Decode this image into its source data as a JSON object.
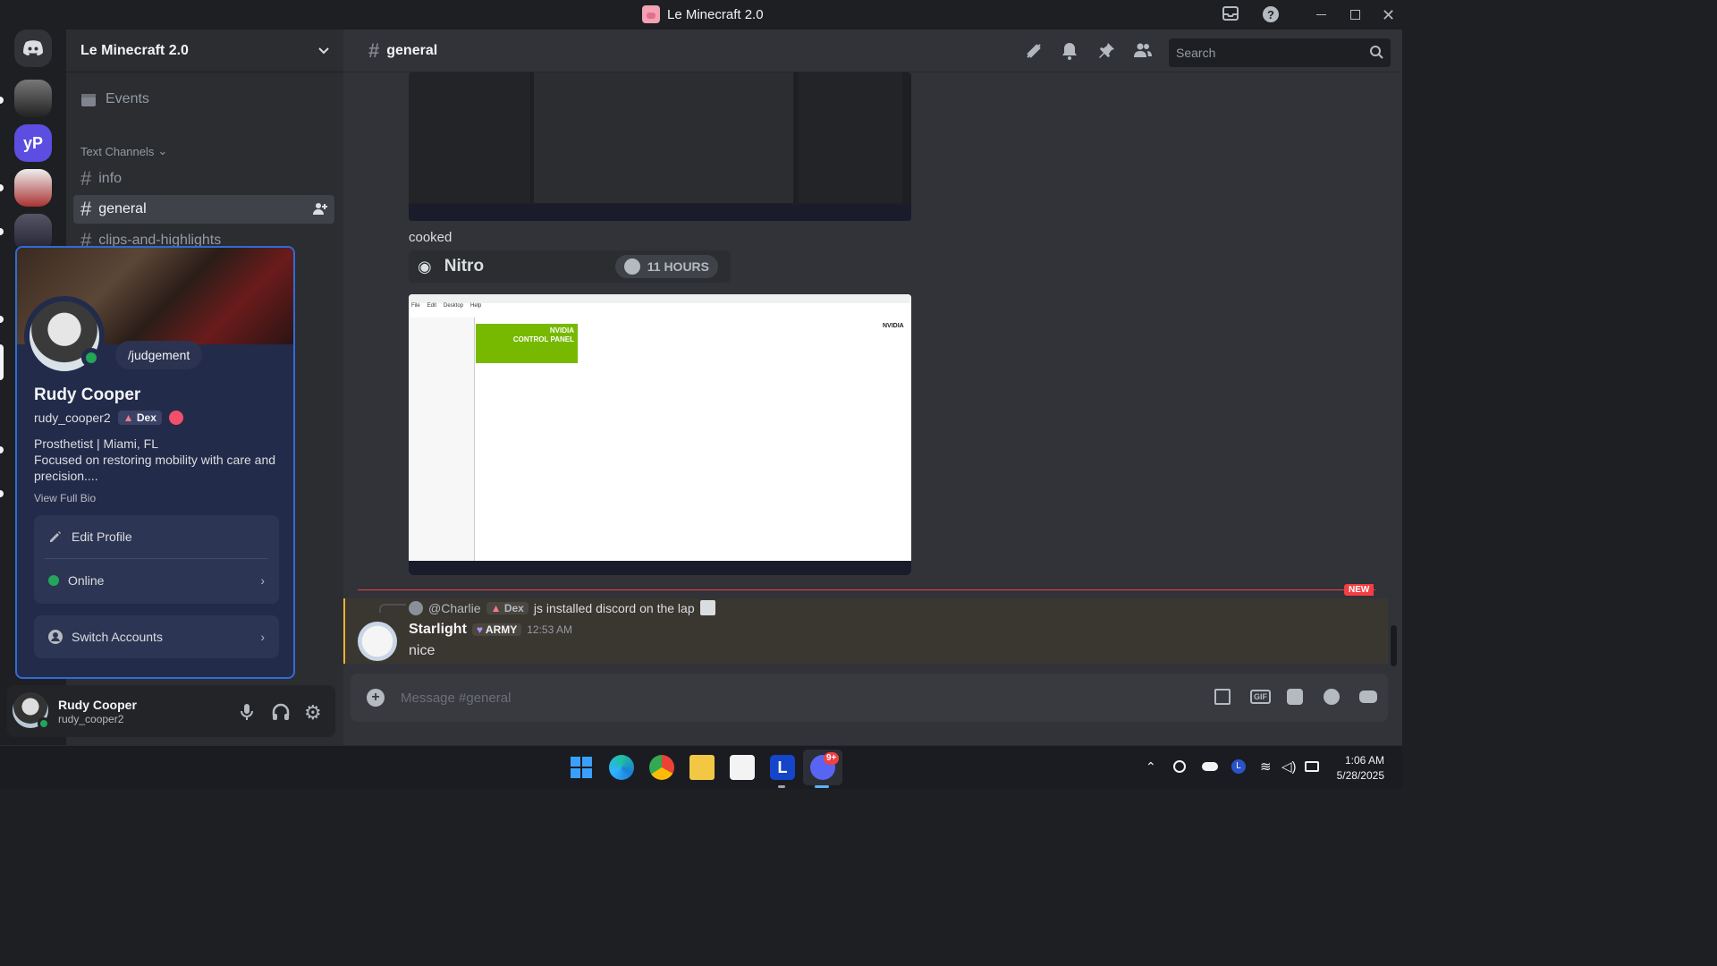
{
  "window": {
    "title": "Le Minecraft 2.0"
  },
  "server": {
    "name": "Le Minecraft 2.0",
    "events_label": "Events",
    "category": "Text Channels"
  },
  "channels": [
    {
      "name": "info"
    },
    {
      "name": "general"
    },
    {
      "name": "clips-and-highlights"
    }
  ],
  "header": {
    "channel": "general",
    "search_placeholder": "Search"
  },
  "profile": {
    "status_text": "/judgement",
    "display_name": "Rudy Cooper",
    "username": "rudy_cooper2",
    "tag": "Dex",
    "bio_line1": "Prosthetist | Miami, FL",
    "bio_line2": "Focused on restoring mobility with care and precision....",
    "view_bio": "View Full Bio",
    "edit_profile": "Edit Profile",
    "online": "Online",
    "switch_accounts": "Switch Accounts"
  },
  "user_panel": {
    "name": "Rudy Cooper",
    "username": "rudy_cooper2"
  },
  "messages": {
    "cooked": "cooked",
    "nitro_label": "Nitro",
    "nitro_timer": "11 HOURS",
    "new_badge": "NEW",
    "reply_user": "@Charlie",
    "reply_tag": "Dex",
    "reply_text": "js installed discord on the lap",
    "author": "Starlight",
    "author_tag": "ARMY",
    "time": "12:53 AM",
    "text": "nice"
  },
  "screenshot2": {
    "menu": [
      "File",
      "Edit",
      "Desktop",
      "Help"
    ],
    "banner_line1": "NVIDIA",
    "banner_line2": "CONTROL PANEL",
    "brand": "NVIDIA"
  },
  "composer": {
    "placeholder": "Message #general"
  },
  "taskbar": {
    "time": "1:06 AM",
    "date": "5/28/2025",
    "badge": "9+"
  },
  "colors": {
    "accent": "#5865f2",
    "online": "#23a55a",
    "mention_line": "#f23f43",
    "nvidia": "#76b900"
  }
}
